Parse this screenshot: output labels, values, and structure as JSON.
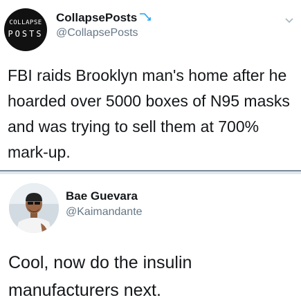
{
  "tweet_top": {
    "avatar_logo_line1": "COLLAPSE",
    "avatar_logo_line2": "POSTS",
    "display_name": "CollapsePosts",
    "handle": "@CollapsePosts",
    "text": "FBI raids Brooklyn man's home after he hoarded over 5000 boxes of N95 masks and was trying to sell them at 700% mark-up."
  },
  "tweet_bottom": {
    "display_name": "Bae Guevara",
    "handle": "@Kaimandante",
    "text": "Cool, now do the insulin manufacturers next."
  },
  "colors": {
    "text_primary": "#14171a",
    "text_secondary": "#657786",
    "divider": "#e1e8ed",
    "link_blue": "#1da1f2"
  },
  "icons": {
    "name_icon": "trend-down-icon",
    "menu": "chevron-down-icon"
  }
}
